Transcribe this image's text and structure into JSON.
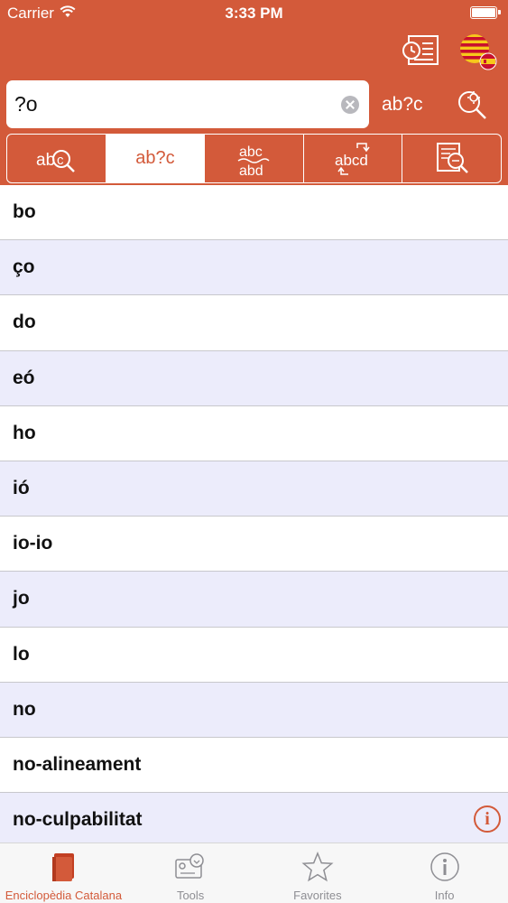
{
  "status_bar": {
    "carrier": "Carrier",
    "time": "3:33 PM"
  },
  "header": {
    "history_icon": "history-list-icon",
    "language_icon": "catalan-spanish-flag-icon",
    "search": {
      "value": "?o",
      "placeholder": ""
    },
    "mode_label": "ab?c",
    "settings_icon": "search-settings-icon"
  },
  "segments": [
    {
      "id": "search-text",
      "label": "",
      "icon": "text-search-icon",
      "active": false
    },
    {
      "id": "wildcard",
      "label": "ab?c",
      "icon": "",
      "active": true
    },
    {
      "id": "similar",
      "label": "",
      "icon": "similar-words-icon",
      "active": false
    },
    {
      "id": "anagram",
      "label": "",
      "icon": "anagram-icon",
      "active": false
    },
    {
      "id": "fulltext",
      "label": "",
      "icon": "full-text-search-icon",
      "active": false
    }
  ],
  "results": [
    "bo",
    "ço",
    "do",
    "eó",
    "ho",
    "ió",
    "io-io",
    "jo",
    "lo",
    "no",
    "no-alineament",
    "no-culpabilitat"
  ],
  "tabbar": {
    "tabs": [
      {
        "label": "Enciclopèdia Catalana",
        "icon": "book-icon",
        "active": true
      },
      {
        "label": "Tools",
        "icon": "tools-icon",
        "active": false
      },
      {
        "label": "Favorites",
        "icon": "star-icon",
        "active": false
      },
      {
        "label": "Info",
        "icon": "info-icon",
        "active": false
      }
    ]
  },
  "colors": {
    "accent": "#d35a3a",
    "alt_row": "#ececfb",
    "inactive_tab": "#8e8e93"
  }
}
